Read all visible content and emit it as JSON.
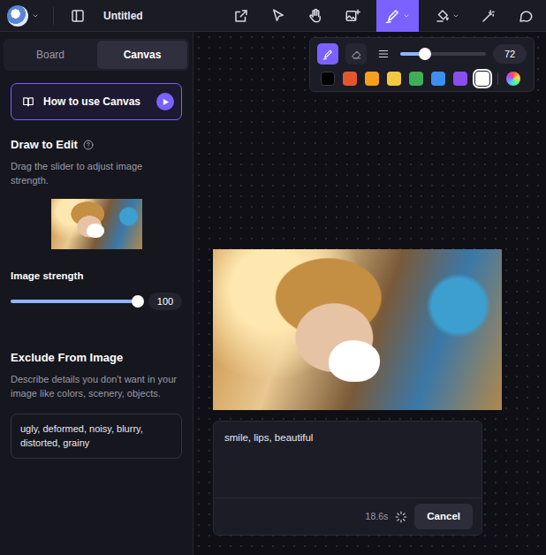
{
  "topbar": {
    "title": "Untitled",
    "tools": [
      {
        "kind": "export",
        "selected": false,
        "menu": false
      },
      {
        "kind": "select",
        "selected": false,
        "menu": false
      },
      {
        "kind": "hand",
        "selected": false,
        "menu": false
      },
      {
        "kind": "image",
        "selected": false,
        "menu": false
      },
      {
        "kind": "pen",
        "selected": true,
        "menu": true
      },
      {
        "kind": "fill",
        "selected": false,
        "menu": true
      },
      {
        "kind": "wand",
        "selected": false,
        "menu": false
      },
      {
        "kind": "comment",
        "selected": false,
        "menu": false
      }
    ]
  },
  "sidebar": {
    "tabs": [
      {
        "label": "Board",
        "selected": false
      },
      {
        "label": "Canvas",
        "selected": true
      }
    ],
    "guide_button": {
      "label": "How to use Canvas"
    },
    "draw_to_edit": {
      "title": "Draw to Edit",
      "help": "Drag the slider to adjust image strength."
    },
    "image_strength": {
      "label": "Image strength",
      "level": 1,
      "reading": "100"
    },
    "exclude": {
      "title": "Exclude From Image",
      "help": "Describe details you don't want in your image like colors, scenery, objects.",
      "value": "ugly, deformed, noisy, blurry, distorted, grainy"
    }
  },
  "brush_panel": {
    "modes": [
      {
        "kind": "pen",
        "selected": true
      },
      {
        "kind": "eraser",
        "selected": false
      }
    ],
    "size": {
      "level": 0.29,
      "reading": "72"
    },
    "colors": [
      {
        "color": "#000000",
        "selected": false
      },
      {
        "color": "#e4572e",
        "selected": false
      },
      {
        "color": "#f59f1b",
        "selected": false
      },
      {
        "color": "#f5c842",
        "selected": false
      },
      {
        "color": "#3fae57",
        "selected": false
      },
      {
        "color": "#3d8ef0",
        "selected": false
      },
      {
        "color": "#8a4df0",
        "selected": false
      },
      {
        "color": "#ffffff",
        "selected": true
      }
    ],
    "custom_color": {
      "selected": false
    }
  },
  "prompt": {
    "text": "smile, lips, beautiful",
    "elapsed": "18.6s",
    "cancel": "Cancel"
  }
}
